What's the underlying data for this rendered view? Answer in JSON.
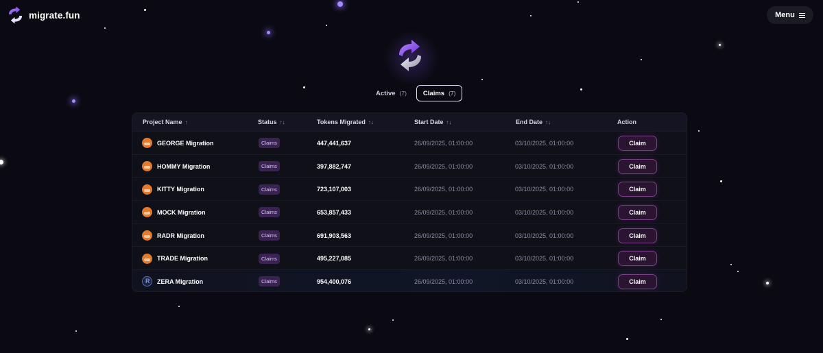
{
  "app": {
    "name": "migrate.fun"
  },
  "header": {
    "menu_label": "Menu"
  },
  "tabs": [
    {
      "label": "Active",
      "count": "(7)",
      "selected": false
    },
    {
      "label": "Claims",
      "count": "(7)",
      "selected": true
    }
  ],
  "table": {
    "headers": {
      "project": "Project Name",
      "status": "Status",
      "tokens": "Tokens Migrated",
      "start": "Start Date",
      "end": "End Date",
      "action": "Action"
    },
    "sort_icons": {
      "asc": "↑",
      "both": "↑↓"
    },
    "rows": [
      {
        "name": "GEORGE Migration",
        "status": "Claims",
        "tokens": "447,441,637",
        "start": "26/09/2025, 01:00:00",
        "end": "03/10/2025, 01:00:00",
        "action": "Claim"
      },
      {
        "name": "HOMMY Migration",
        "status": "Claims",
        "tokens": "397,882,747",
        "start": "26/09/2025, 01:00:00",
        "end": "03/10/2025, 01:00:00",
        "action": "Claim"
      },
      {
        "name": "KITTY Migration",
        "status": "Claims",
        "tokens": "723,107,003",
        "start": "26/09/2025, 01:00:00",
        "end": "03/10/2025, 01:00:00",
        "action": "Claim"
      },
      {
        "name": "MOCK Migration",
        "status": "Claims",
        "tokens": "653,857,433",
        "start": "26/09/2025, 01:00:00",
        "end": "03/10/2025, 01:00:00",
        "action": "Claim"
      },
      {
        "name": "RADR Migration",
        "status": "Claims",
        "tokens": "691,903,563",
        "start": "26/09/2025, 01:00:00",
        "end": "03/10/2025, 01:00:00",
        "action": "Claim"
      },
      {
        "name": "TRADE Migration",
        "status": "Claims",
        "tokens": "495,227,085",
        "start": "26/09/2025, 01:00:00",
        "end": "03/10/2025, 01:00:00",
        "action": "Claim"
      },
      {
        "name": "ZERA Migration",
        "status": "Claims",
        "tokens": "954,400,076",
        "start": "26/09/2025, 01:00:00",
        "end": "03/10/2025, 01:00:00",
        "action": "Claim"
      }
    ]
  },
  "colors": {
    "background": "#0b0a12",
    "accent": "#7a3f86",
    "badge": "#3a2352"
  }
}
